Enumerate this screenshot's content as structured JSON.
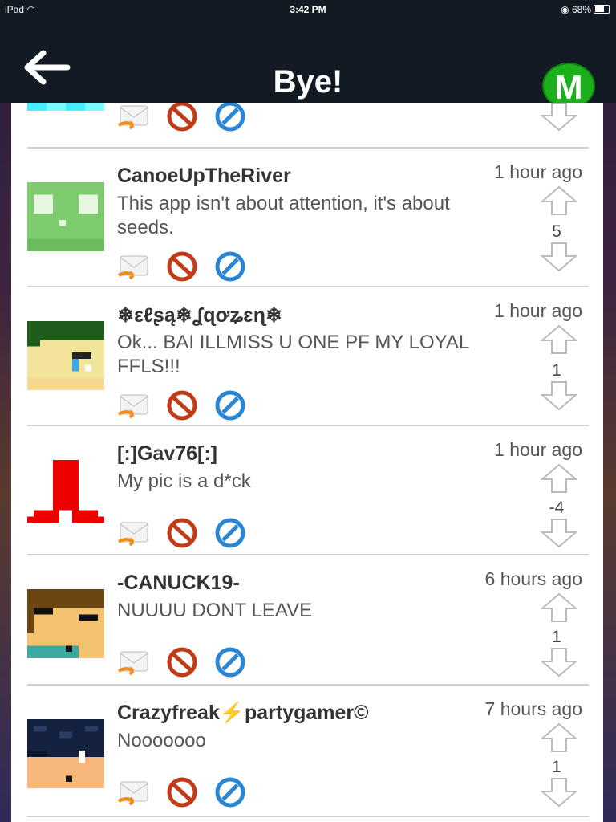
{
  "status_bar": {
    "device": "iPad",
    "wifi_icon": "wifi-icon",
    "time": "3:42 PM",
    "battery": "68%"
  },
  "nav": {
    "title": "Bye!",
    "badge": "M",
    "back_icon": "arrow-left-icon"
  },
  "actions": {
    "reply_icon": "envelope-reply-icon",
    "block_icon": "no-sign-icon",
    "report_icon": "forbidden-icon"
  },
  "posts": [
    {
      "username": "CanoeUpTheRiver",
      "time": "1 hour ago",
      "message": "This app isn't about attention, it's about seeds.",
      "score": "5"
    },
    {
      "username": "❄εℓʂą❄ʆɋơʑɛɳ❄",
      "time": "1 hour ago",
      "message": "Ok... BAI ILLMISS U ONE PF MY LOYAL FFLS!!!",
      "score": "1"
    },
    {
      "username": "[:]Gav76[:]",
      "time": "1 hour ago",
      "message": "My pic is a d*ck",
      "score": "-4"
    },
    {
      "username": "-CANUCK19-",
      "time": "6 hours ago",
      "message": "NUUUU DONT LEAVE",
      "score": "1"
    },
    {
      "username": "Crazyfreak⚡partygamer©",
      "time": "7 hours ago",
      "message": "Nooooooo",
      "score": "1"
    }
  ]
}
